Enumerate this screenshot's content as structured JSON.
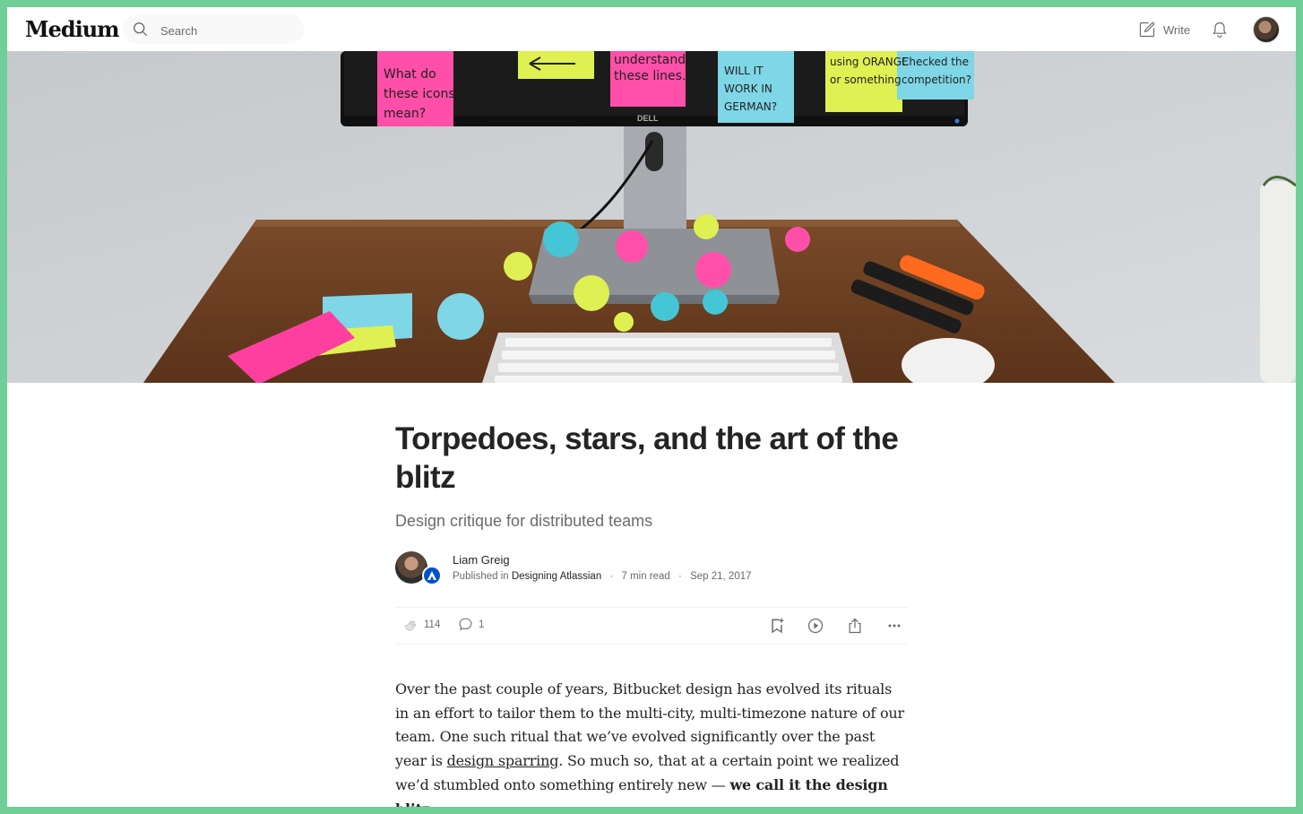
{
  "header": {
    "logo": "Medium",
    "search_placeholder": "Search",
    "write_label": "Write",
    "icons": [
      "search-icon",
      "write-icon",
      "bell-icon",
      "avatar"
    ]
  },
  "hero": {
    "sticky_notes": [
      "What do these icons mean?",
      "understand these lines...",
      "WILL IT WORK IN GERMAN?",
      "using ORANGE or something",
      "Checked the competition?"
    ],
    "monitor_brand": "DELL"
  },
  "article": {
    "title": "Torpedoes, stars, and the art of the blitz",
    "subtitle": "Design critique for distributed teams",
    "author": "Liam Greig",
    "published_in_prefix": "Published in",
    "publication": "Designing Atlassian",
    "read_time": "7 min read",
    "date": "Sep 21, 2017",
    "claps": "114",
    "responses": "1",
    "body": {
      "p1_before_link": "Over the past couple of years, Bitbucket design has evolved its rituals in an effort to tailor them to the multi-city, multi-timezone nature of our team. One such ritual that we’ve evolved significantly over the past year is ",
      "p1_link": "design sparring",
      "p1_after_link": ". So much so, that at a certain point we realized we’d stumbled onto something entirely new — ",
      "p1_bold": "we call it the design blitz."
    }
  },
  "colors": {
    "frame": "#6fcf97",
    "text": "#242424",
    "muted": "#6b6b6b",
    "atlassian_blue": "#0052cc"
  }
}
